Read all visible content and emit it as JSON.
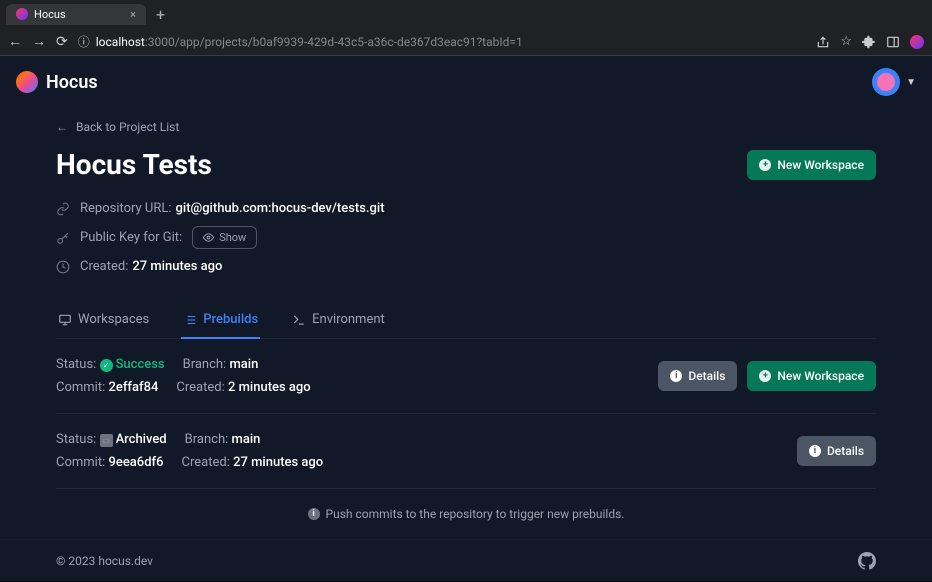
{
  "browser": {
    "tab_title": "Hocus",
    "url_host": "localhost",
    "url_path": ":3000/app/projects/b0af9939-429d-43c5-a36c-de367d3eac91?tabId=1"
  },
  "app": {
    "name": "Hocus",
    "back_link": "Back to Project List",
    "title": "Hocus Tests",
    "new_workspace_label": "New Workspace",
    "meta": {
      "repo_label": "Repository URL:",
      "repo_value": "git@github.com:hocus-dev/tests.git",
      "pubkey_label": "Public Key for Git:",
      "pubkey_button": "Show",
      "created_label": "Created:",
      "created_value": "27 minutes ago"
    }
  },
  "tabs": {
    "workspaces": "Workspaces",
    "prebuilds": "Prebuilds",
    "environment": "Environment"
  },
  "builds": [
    {
      "status_label": "Status:",
      "status_value": "Success",
      "status_kind": "success",
      "branch_label": "Branch:",
      "branch_value": "main",
      "commit_label": "Commit:",
      "commit_value": "2effaf84",
      "created_label": "Created:",
      "created_value": "2 minutes ago",
      "details_label": "Details",
      "new_workspace_label": "New Workspace"
    },
    {
      "status_label": "Status:",
      "status_value": "Archived",
      "status_kind": "archived",
      "branch_label": "Branch:",
      "branch_value": "main",
      "commit_label": "Commit:",
      "commit_value": "9eea6df6",
      "created_label": "Created:",
      "created_value": "27 minutes ago",
      "details_label": "Details"
    }
  ],
  "hint": "Push commits to the repository to trigger new prebuilds.",
  "footer": {
    "copyright": "© 2023 hocus.dev"
  }
}
